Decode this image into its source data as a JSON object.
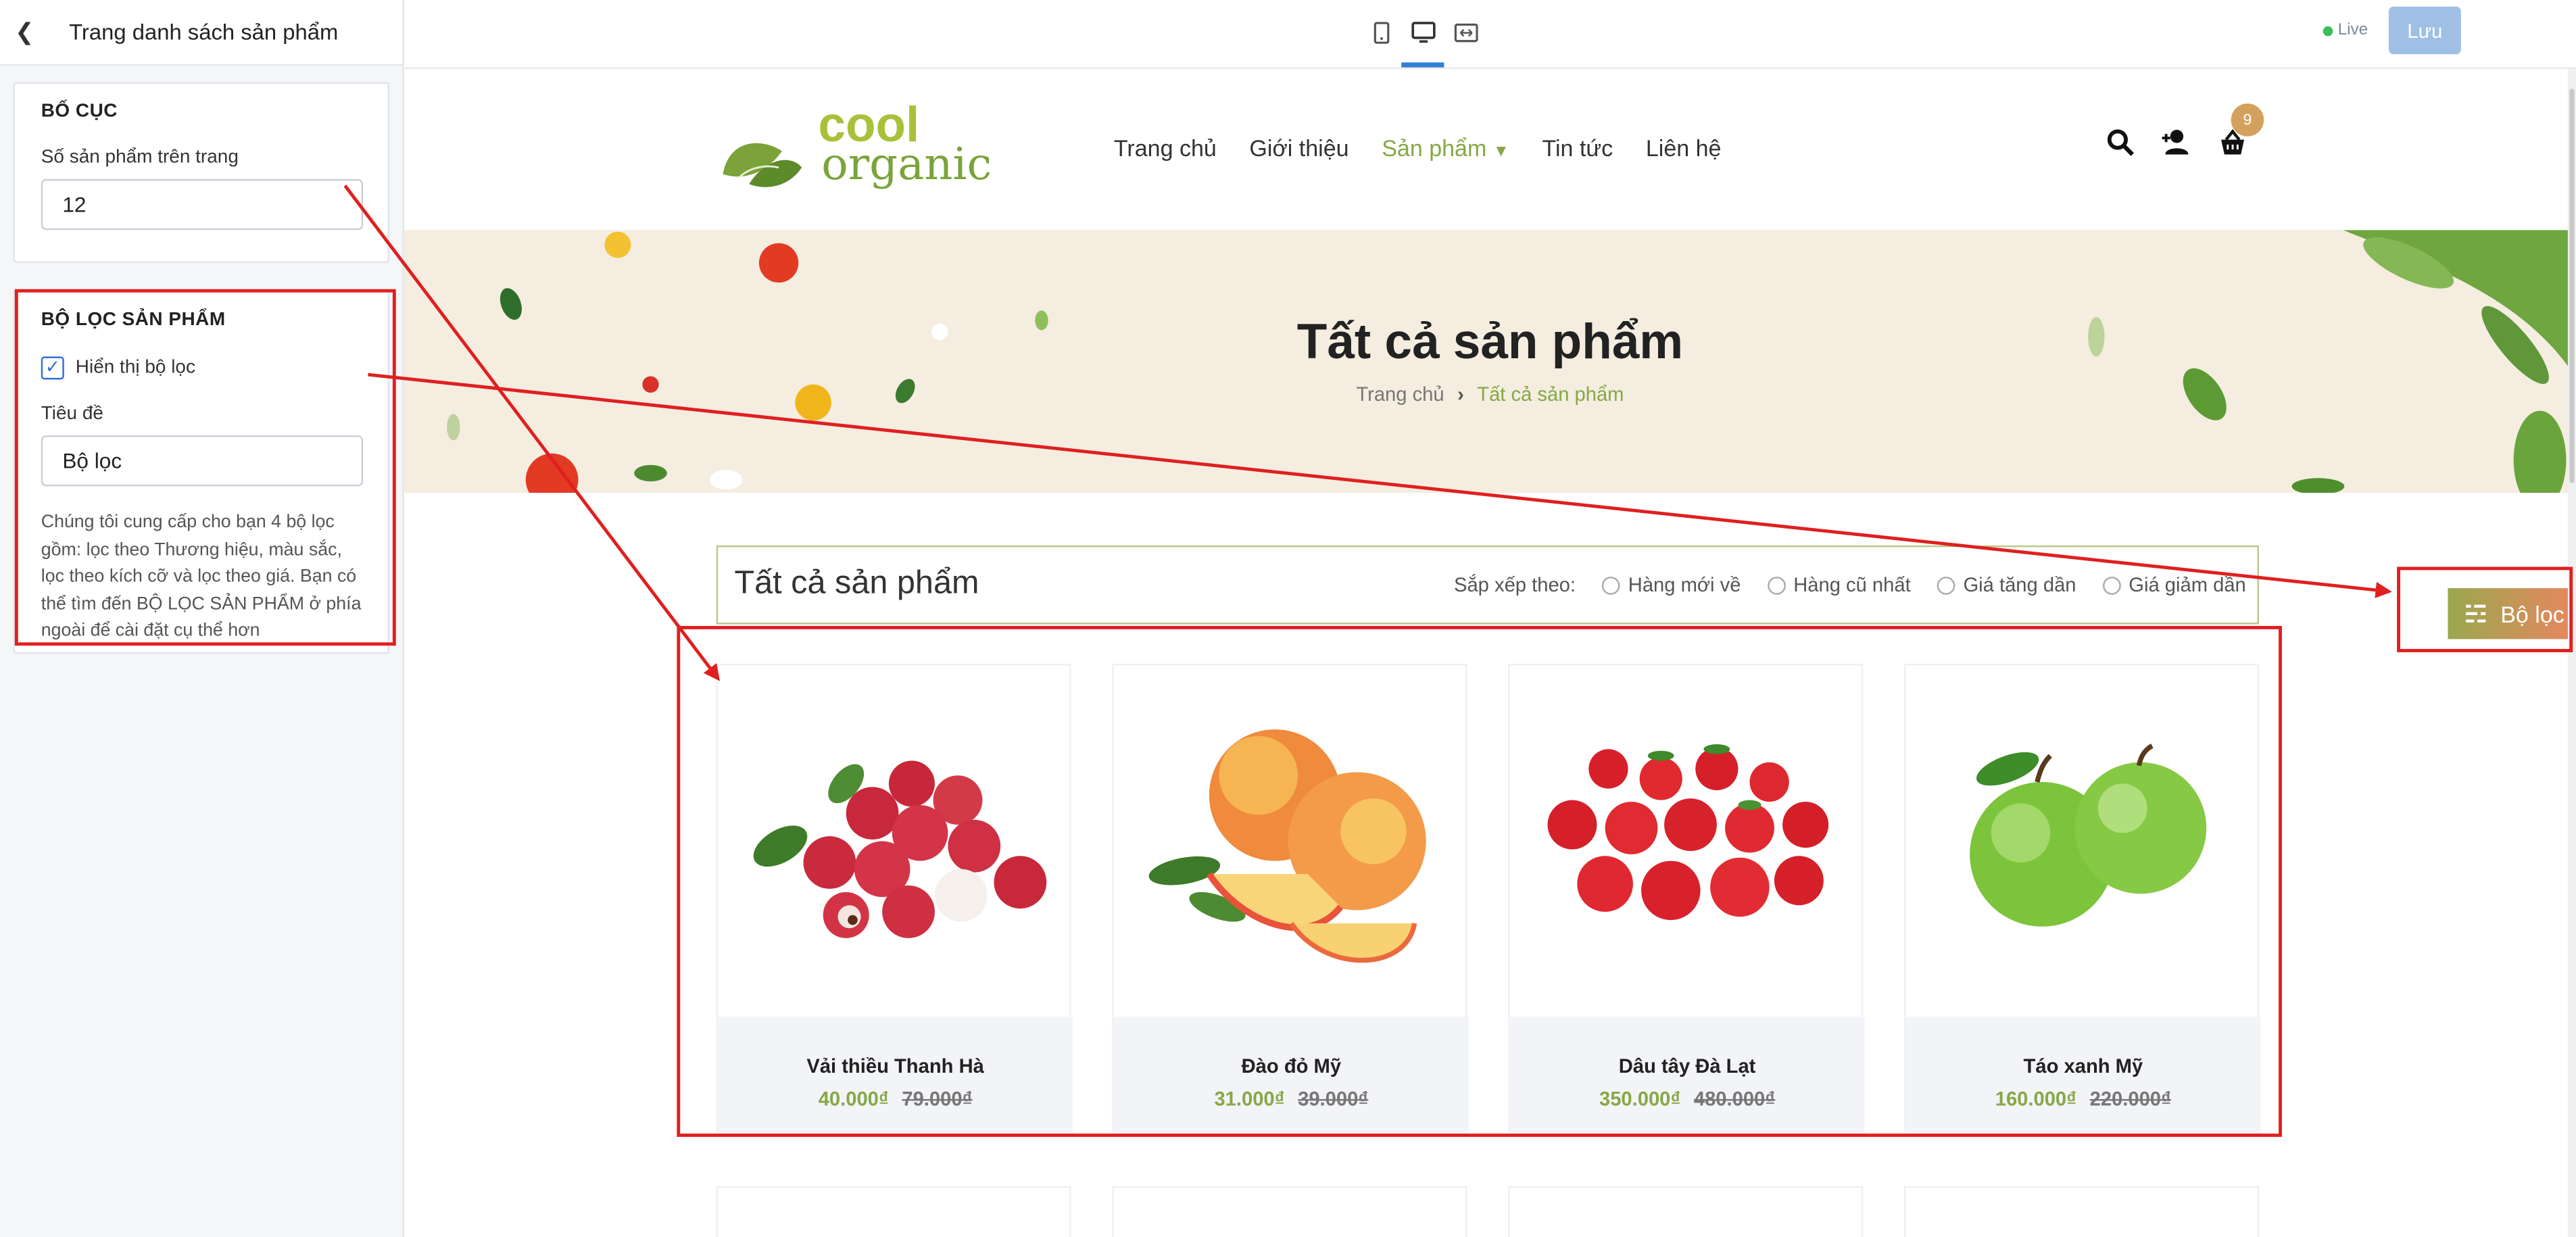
{
  "panel": {
    "title": "Trang danh sách sản phẩm",
    "layout_section": {
      "heading": "BỐ CỤC",
      "per_page_label": "Số sản phẩm trên trang",
      "per_page_value": "12"
    },
    "filter_section": {
      "heading": "BỘ LỌC SẢN PHẨM",
      "show_filter_label": "Hiển thị bộ lọc",
      "show_filter_checked": true,
      "title_label": "Tiêu đề",
      "title_value": "Bộ lọc",
      "description": "Chúng tôi cung cấp cho bạn 4 bộ lọc gồm: lọc theo Thương hiệu, màu sắc, lọc theo kích cỡ và lọc theo giá. Bạn có thể tìm đến BỘ LỌC SẢN PHẨM ở phía ngoài để cài đặt cụ thể hơn"
    }
  },
  "toolbar": {
    "devices": [
      "mobile-icon",
      "desktop-icon",
      "fullwidth-icon"
    ],
    "live_label": "Live",
    "save_label": "Lưu"
  },
  "store": {
    "logo_line1": "cool",
    "logo_line2": "organic",
    "nav": [
      "Trang chủ",
      "Giới thiệu",
      "Sản phẩm",
      "Tin tức",
      "Liên hệ"
    ],
    "active_nav": "Sản phẩm",
    "cart_count": "9",
    "banner_title": "Tất cả sản phẩm",
    "breadcrumb_home": "Trang chủ",
    "breadcrumb_sep": "›",
    "breadcrumb_current": "Tất cả sản phẩm",
    "listing_heading": "Tất cả sản phẩm",
    "sort_label": "Sắp xếp theo:",
    "sort_options": [
      "Hàng mới về",
      "Hàng cũ nhất",
      "Giá tăng dần",
      "Giá giảm dần"
    ],
    "filter_button_label": "Bộ lọc",
    "products": [
      {
        "name": "Vải thiều Thanh Hà",
        "price": "40.000₫",
        "old_price": "79.000₫",
        "image": "lychee"
      },
      {
        "name": "Đào đỏ Mỹ",
        "price": "31.000₫",
        "old_price": "39.000₫",
        "image": "peach"
      },
      {
        "name": "Dâu tây Đà Lạt",
        "price": "350.000₫",
        "old_price": "480.000₫",
        "image": "strawberry"
      },
      {
        "name": "Táo xanh Mỹ",
        "price": "160.000₫",
        "old_price": "220.000₫",
        "image": "green-apple"
      }
    ]
  },
  "colors": {
    "accent_green": "#86a845",
    "annotation_red": "#e01f1f",
    "save_button": "#9fc0e4",
    "banner_bg": "#f4ede0"
  }
}
